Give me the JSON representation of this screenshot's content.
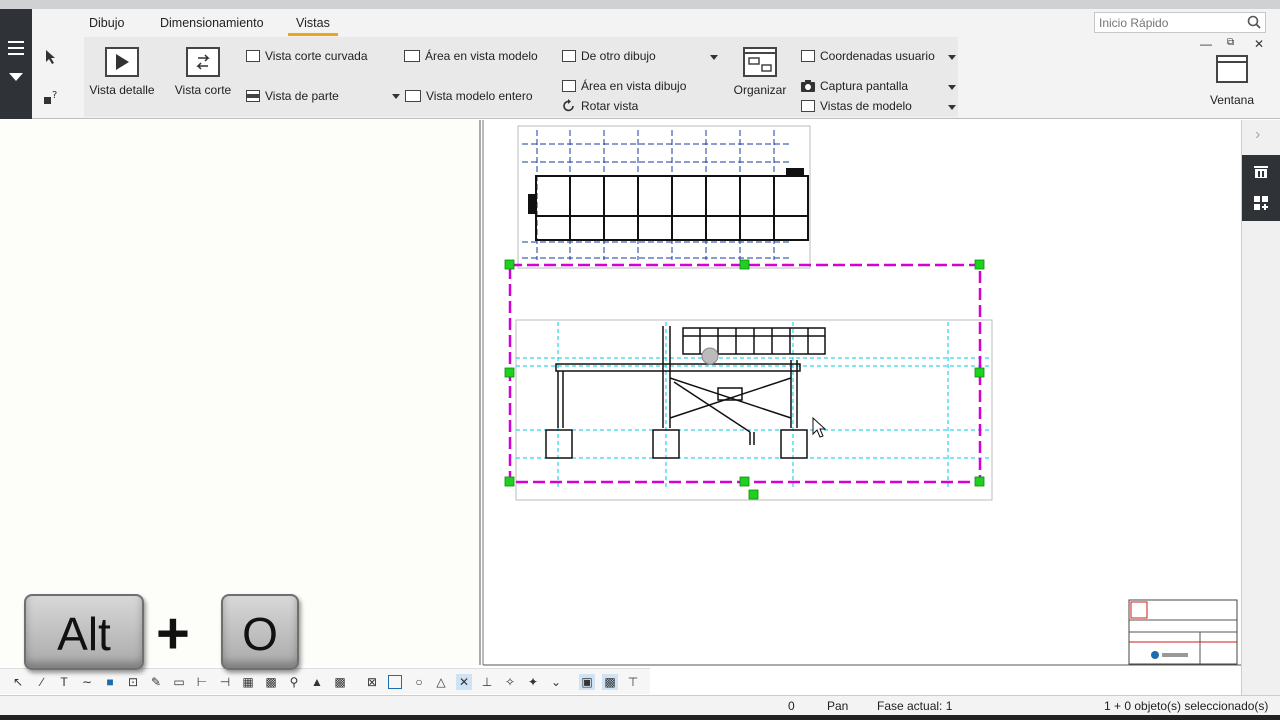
{
  "ribbon": {
    "tabs": [
      {
        "label": "Dibujo"
      },
      {
        "label": "Dimensionamiento"
      },
      {
        "label": "Vistas",
        "active": true
      }
    ],
    "quick_search": {
      "placeholder": "Inicio Rápido"
    },
    "big_buttons": {
      "vista_detalle": "Vista detalle",
      "vista_corte": "Vista corte",
      "organizar": "Organizar",
      "ventana": "Ventana"
    },
    "small_buttons": {
      "vista_corte_curvada": "Vista corte curvada",
      "vista_de_parte": "Vista de parte",
      "area_vista_modelo": "Área en vista modelo",
      "vista_modelo_entero": "Vista modelo entero",
      "de_otro_dibujo": "De otro dibujo",
      "area_vista_dibujo": "Área en vista dibujo",
      "rotar_vista": "Rotar vista",
      "coordenadas_usuario": "Coordenadas usuario",
      "captura_pantalla": "Captura pantalla",
      "vistas_de_modelo": "Vistas de modelo"
    }
  },
  "status": {
    "value": "0",
    "mode": "Pan",
    "phase": "Fase actual: 1",
    "selection": "1 + 0 objeto(s) seleccionado(s)"
  },
  "keys": {
    "key1": "Alt",
    "plus": "+",
    "key2": "O"
  },
  "colors": {
    "accent": "#f0a41c",
    "selection_frame": "#d400d4",
    "handle": "#1fd11f",
    "grid_line": "#00c8e6",
    "dark_panel": "#2f3338"
  }
}
